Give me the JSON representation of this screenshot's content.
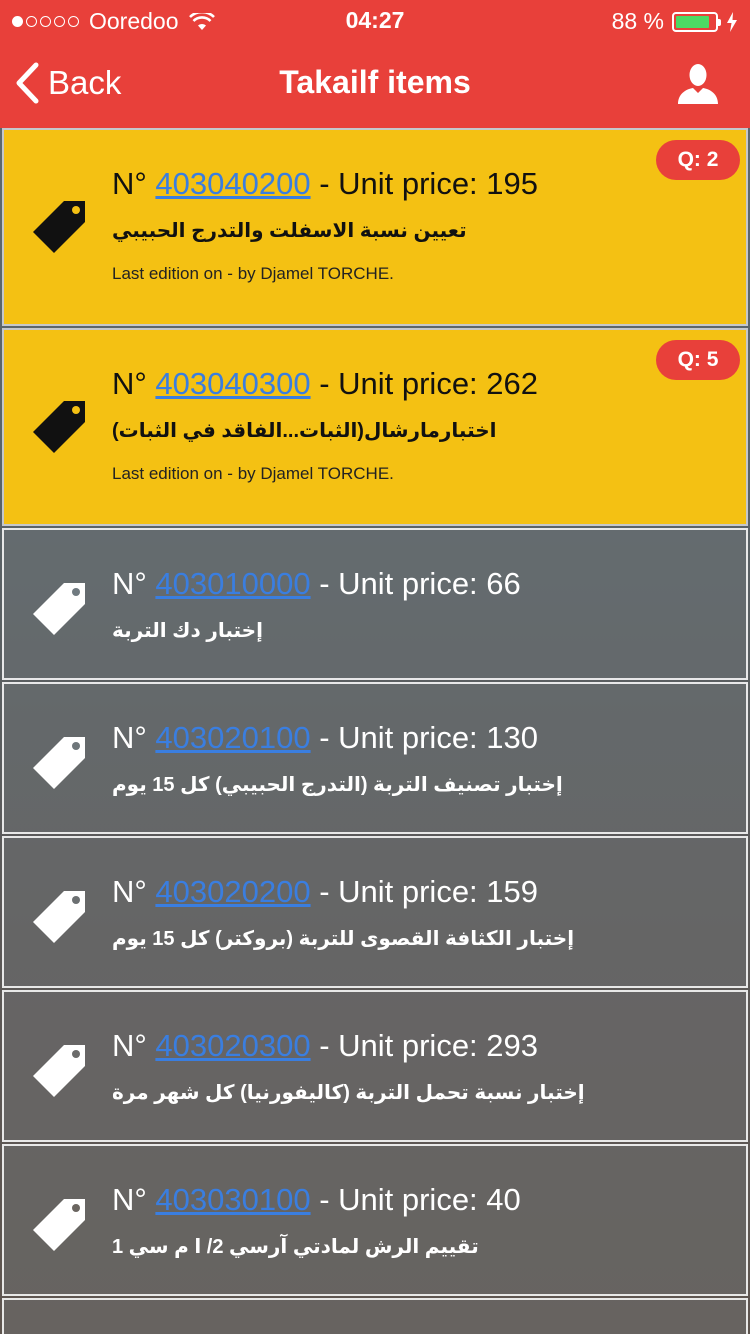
{
  "status_bar": {
    "carrier": "Ooredoo",
    "time": "04:27",
    "battery": "88 %",
    "battery_level": 0.88
  },
  "nav": {
    "back_label": "Back",
    "title": "Takailf items"
  },
  "items": [
    {
      "prefix": "N° ",
      "number": "403040200",
      "price_text": " - Unit price: 195",
      "desc": "تعيين نسبة الاسفلت والتدرج الحبيبي",
      "edition": "Last edition on - by Djamel TORCHE.",
      "qty": "Q: 2"
    },
    {
      "prefix": "N° ",
      "number": "403040300",
      "price_text": " - Unit price: 262",
      "desc": "(اختبارمارشال(الثبات...الفاقد في الثبات",
      "edition": "Last edition on - by Djamel TORCHE.",
      "qty": "Q: 5"
    },
    {
      "prefix": "N° ",
      "number": "403010000",
      "price_text": " - Unit price: 66",
      "desc": "إختبار دك التربة"
    },
    {
      "prefix": "N° ",
      "number": "403020100",
      "price_text": " - Unit price: 130",
      "desc": "إختبار تصنيف التربة (التدرج الحبيبي) كل 15 يوم"
    },
    {
      "prefix": "N° ",
      "number": "403020200",
      "price_text": " - Unit price: 159",
      "desc": "إختبار الكثافة القصوى للتربة (بروكتر) كل 15 يوم"
    },
    {
      "prefix": "N° ",
      "number": "403020300",
      "price_text": " - Unit price: 293",
      "desc": "إختبار نسبة تحمل التربة (كاليفورنيا) كل شهر مرة"
    },
    {
      "prefix": "N° ",
      "number": "403030100",
      "price_text": " - Unit price: 40",
      "desc": "تقييم الرش لمادتي آرسي 2/ ا م سي 1"
    }
  ],
  "colors": {
    "nav_bar": "#e8403a",
    "highlight_row": "#f4c113",
    "link": "#3a7ee0",
    "battery": "#4cd964"
  },
  "icons": {
    "back": "chevron-left-icon",
    "profile": "user-icon",
    "item": "price-tag-icon"
  }
}
